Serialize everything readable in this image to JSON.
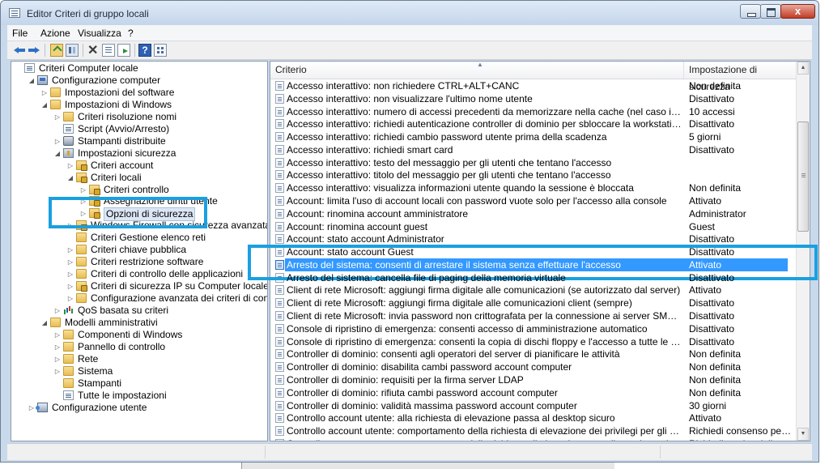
{
  "window": {
    "title": "Editor Criteri di gruppo locali",
    "close_glyph": "x"
  },
  "menu": [
    "File",
    "Azione",
    "Visualizza",
    "?"
  ],
  "toolbar": {
    "help_glyph": "?",
    "delete_glyph": "✕"
  },
  "tree": [
    {
      "label": "Criteri Computer locale",
      "icon": "policy-doc-icon",
      "depth": 0,
      "expander": ""
    },
    {
      "label": "Configurazione computer",
      "icon": "computer-icon",
      "depth": 1,
      "expander": "◢"
    },
    {
      "label": "Impostazioni del software",
      "icon": "folder-icon",
      "depth": 2,
      "expander": "▷"
    },
    {
      "label": "Impostazioni di Windows",
      "icon": "folder-icon",
      "depth": 2,
      "expander": "◢"
    },
    {
      "label": "Criteri risoluzione nomi",
      "icon": "folder-icon",
      "depth": 3,
      "expander": "▷"
    },
    {
      "label": "Script (Avvio/Arresto)",
      "icon": "script-icon",
      "depth": 3,
      "expander": ""
    },
    {
      "label": "Stampanti distribuite",
      "icon": "printer-icon",
      "depth": 3,
      "expander": "▷"
    },
    {
      "label": "Impostazioni sicurezza",
      "icon": "security-settings-icon",
      "depth": 3,
      "expander": "◢"
    },
    {
      "label": "Criteri account",
      "icon": "secure-folder-icon",
      "depth": 4,
      "expander": "▷"
    },
    {
      "label": "Criteri locali",
      "icon": "secure-folder-icon",
      "depth": 4,
      "expander": "◢"
    },
    {
      "label": "Criteri controllo",
      "icon": "secure-folder-icon",
      "depth": 5,
      "expander": "▷"
    },
    {
      "label": "Assegnazione diritti utente",
      "icon": "secure-folder-icon",
      "depth": 5,
      "expander": "▷"
    },
    {
      "label": "Opzioni di sicurezza",
      "icon": "secure-folder-icon",
      "depth": 5,
      "expander": "▷",
      "selected": true
    },
    {
      "label": "Windows Firewall con sicurezza avanzata",
      "icon": "secure-folder-icon",
      "depth": 4,
      "expander": "▷"
    },
    {
      "label": "Criteri Gestione elenco reti",
      "icon": "folder-icon",
      "depth": 4,
      "expander": ""
    },
    {
      "label": "Criteri chiave pubblica",
      "icon": "folder-icon",
      "depth": 4,
      "expander": "▷"
    },
    {
      "label": "Criteri restrizione software",
      "icon": "folder-icon",
      "depth": 4,
      "expander": "▷"
    },
    {
      "label": "Criteri di controllo delle applicazioni",
      "icon": "folder-icon",
      "depth": 4,
      "expander": "▷"
    },
    {
      "label": "Criteri di sicurezza IP su Computer locale",
      "icon": "secure-folder-icon",
      "depth": 4,
      "expander": "▷"
    },
    {
      "label": "Configurazione avanzata dei criteri di controllo",
      "icon": "folder-icon",
      "depth": 4,
      "expander": "▷"
    },
    {
      "label": "QoS basata su criteri",
      "icon": "qos-chart-icon",
      "depth": 3,
      "expander": "▷"
    },
    {
      "label": "Modelli amministrativi",
      "icon": "folder-icon",
      "depth": 2,
      "expander": "◢"
    },
    {
      "label": "Componenti di Windows",
      "icon": "folder-icon",
      "depth": 3,
      "expander": "▷"
    },
    {
      "label": "Pannello di controllo",
      "icon": "folder-icon",
      "depth": 3,
      "expander": "▷"
    },
    {
      "label": "Rete",
      "icon": "folder-icon",
      "depth": 3,
      "expander": "▷"
    },
    {
      "label": "Sistema",
      "icon": "folder-icon",
      "depth": 3,
      "expander": "▷"
    },
    {
      "label": "Stampanti",
      "icon": "folder-icon",
      "depth": 3,
      "expander": ""
    },
    {
      "label": "Tutte le impostazioni",
      "icon": "policy-doc-icon",
      "depth": 3,
      "expander": ""
    },
    {
      "label": "Configurazione utente",
      "icon": "user-icon",
      "depth": 1,
      "expander": "▷"
    }
  ],
  "list": {
    "col_policy": "Criterio",
    "col_setting": "Impostazione di sicurezza",
    "rows": [
      {
        "policy": "Accesso interattivo: non richiedere CTRL+ALT+CANC",
        "setting": "Non definita"
      },
      {
        "policy": "Accesso interattivo: non visualizzare l'ultimo nome utente",
        "setting": "Disattivato"
      },
      {
        "policy": "Accesso interattivo: numero di accessi precedenti da memorizzare nella cache (nel caso in cui il controller di d...",
        "setting": "10 accessi"
      },
      {
        "policy": "Accesso interattivo: richiedi autenticazione controller di dominio per sbloccare la workstation",
        "setting": "Disattivato"
      },
      {
        "policy": "Accesso interattivo: richiedi cambio password utente prima della scadenza",
        "setting": "5 giorni"
      },
      {
        "policy": "Accesso interattivo: richiedi smart card",
        "setting": "Disattivato"
      },
      {
        "policy": "Accesso interattivo: testo del messaggio per gli utenti che tentano l'accesso",
        "setting": ""
      },
      {
        "policy": "Accesso interattivo: titolo del messaggio per gli utenti che tentano l'accesso",
        "setting": ""
      },
      {
        "policy": "Accesso interattivo: visualizza informazioni utente quando la sessione è bloccata",
        "setting": "Non definita"
      },
      {
        "policy": "Account: limita l'uso di account locali con password vuote solo per l'accesso alla console",
        "setting": "Attivato"
      },
      {
        "policy": "Account: rinomina account amministratore",
        "setting": "Administrator"
      },
      {
        "policy": "Account: rinomina account guest",
        "setting": "Guest"
      },
      {
        "policy": "Account: stato account Administrator",
        "setting": "Disattivato"
      },
      {
        "policy": "Account: stato account Guest",
        "setting": "Disattivato"
      },
      {
        "policy": "Arresto del sistema: consenti di arrestare il sistema senza effettuare l'accesso",
        "setting": "Attivato",
        "selected": true
      },
      {
        "policy": "Arresto del sistema: cancella file di paging della memoria virtuale",
        "setting": "Disattivato"
      },
      {
        "policy": "Client di rete Microsoft: aggiungi firma digitale alle comunicazioni (se autorizzato dal server)",
        "setting": "Attivato"
      },
      {
        "policy": "Client di rete Microsoft: aggiungi firma digitale alle comunicazioni client (sempre)",
        "setting": "Disattivato"
      },
      {
        "policy": "Client di rete Microsoft: invia password non crittografata per la connessione ai server SMB di terzi",
        "setting": "Disattivato"
      },
      {
        "policy": "Console di ripristino di emergenza: consenti accesso di amministrazione automatico",
        "setting": "Disattivato"
      },
      {
        "policy": "Console di ripristino di emergenza: consenti la copia di dischi floppy e l'accesso a tutte le unità e cartelle",
        "setting": "Disattivato"
      },
      {
        "policy": "Controller di dominio: consenti agli operatori del server di pianificare le attività",
        "setting": "Non definita"
      },
      {
        "policy": "Controller di dominio: disabilita cambi password account computer",
        "setting": "Non definita"
      },
      {
        "policy": "Controller di dominio: requisiti per la firma server LDAP",
        "setting": "Non definita"
      },
      {
        "policy": "Controller di dominio: rifiuta cambi password account computer",
        "setting": "Non definita"
      },
      {
        "policy": "Controller di dominio: validità massima password account computer",
        "setting": "30 giorni"
      },
      {
        "policy": "Controllo account utente: alla richiesta di elevazione passa al desktop sicuro",
        "setting": "Attivato"
      },
      {
        "policy": "Controllo account utente: comportamento della richiesta di elevazione dei privilegi per gli amministratori in m...",
        "setting": "Richiedi consenso per fil..."
      },
      {
        "policy": "Controllo account utente: comportamento della richiesta di elevazione per gli utenti standard",
        "setting": "Richiedi credenziali"
      }
    ]
  },
  "colors": {
    "selection": "#3399ff",
    "highlight_annotation": "#1aa0e0",
    "window_frame": "#c9d9ec"
  }
}
